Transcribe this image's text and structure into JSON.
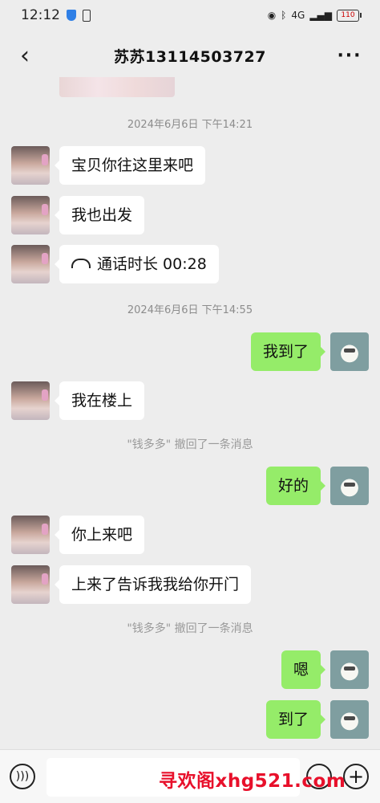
{
  "status_bar": {
    "time": "12:12",
    "network": "4G",
    "battery": "110"
  },
  "nav": {
    "title": "苏苏13114503727",
    "more": "···",
    "back": "‹"
  },
  "timestamps": [
    "2024年6月6日 下午14:21",
    "2024年6月6日 下午14:55"
  ],
  "notices": [
    "\"钱多多\" 撤回了一条消息",
    "\"钱多多\" 撤回了一条消息"
  ],
  "messages": [
    {
      "side": "left",
      "text": "宝贝你往这里来吧"
    },
    {
      "side": "left",
      "text": "我也出发"
    },
    {
      "side": "left",
      "text": "通话时长 00:28",
      "icon": "phone-handset-icon"
    },
    {
      "side": "right",
      "text": "我到了"
    },
    {
      "side": "left",
      "text": "我在楼上"
    },
    {
      "side": "right",
      "text": "好的"
    },
    {
      "side": "left",
      "text": "你上来吧"
    },
    {
      "side": "left",
      "text": "上来了告诉我我给你开门"
    },
    {
      "side": "right",
      "text": "嗯"
    },
    {
      "side": "right",
      "text": "到了"
    }
  ],
  "input": {
    "placeholder": ""
  },
  "watermark": "寻欢阁xhg521.com",
  "colors": {
    "background": "#ededed",
    "sent_bubble": "#95ec69",
    "received_bubble": "#ffffff"
  }
}
